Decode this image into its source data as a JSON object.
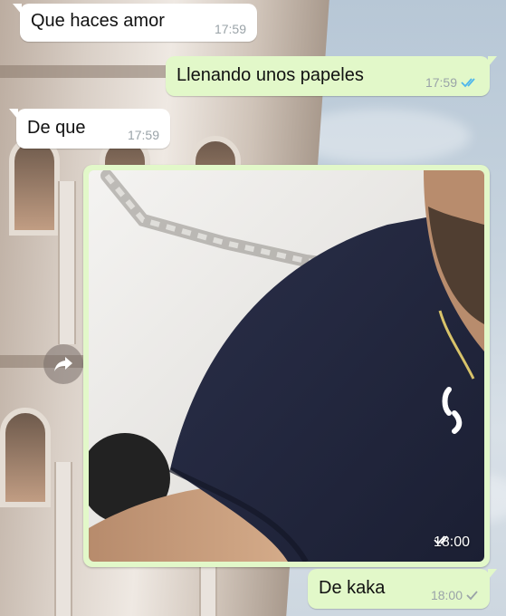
{
  "chat": {
    "messages": [
      {
        "text": "Que haces amor",
        "time": "17:59",
        "direction": "incoming"
      },
      {
        "text": "Llenando unos papeles",
        "time": "17:59",
        "direction": "outgoing",
        "status": "read"
      },
      {
        "text": "De que",
        "time": "17:59",
        "direction": "incoming"
      },
      {
        "type": "photo",
        "time": "18:00",
        "direction": "outgoing",
        "status": "read"
      },
      {
        "text": "De kaka",
        "time": "18:00",
        "direction": "outgoing",
        "status": "delivered"
      }
    ]
  },
  "icons": {
    "forward": "forward-arrow-icon",
    "read": "double-check-icon",
    "delivered": "single-check-icon"
  },
  "colors": {
    "incoming_bubble": "#ffffff",
    "outgoing_bubble": "#e2f8c9",
    "read_ticks": "#4fb6ec",
    "meta_text": "#9aa3a8"
  }
}
